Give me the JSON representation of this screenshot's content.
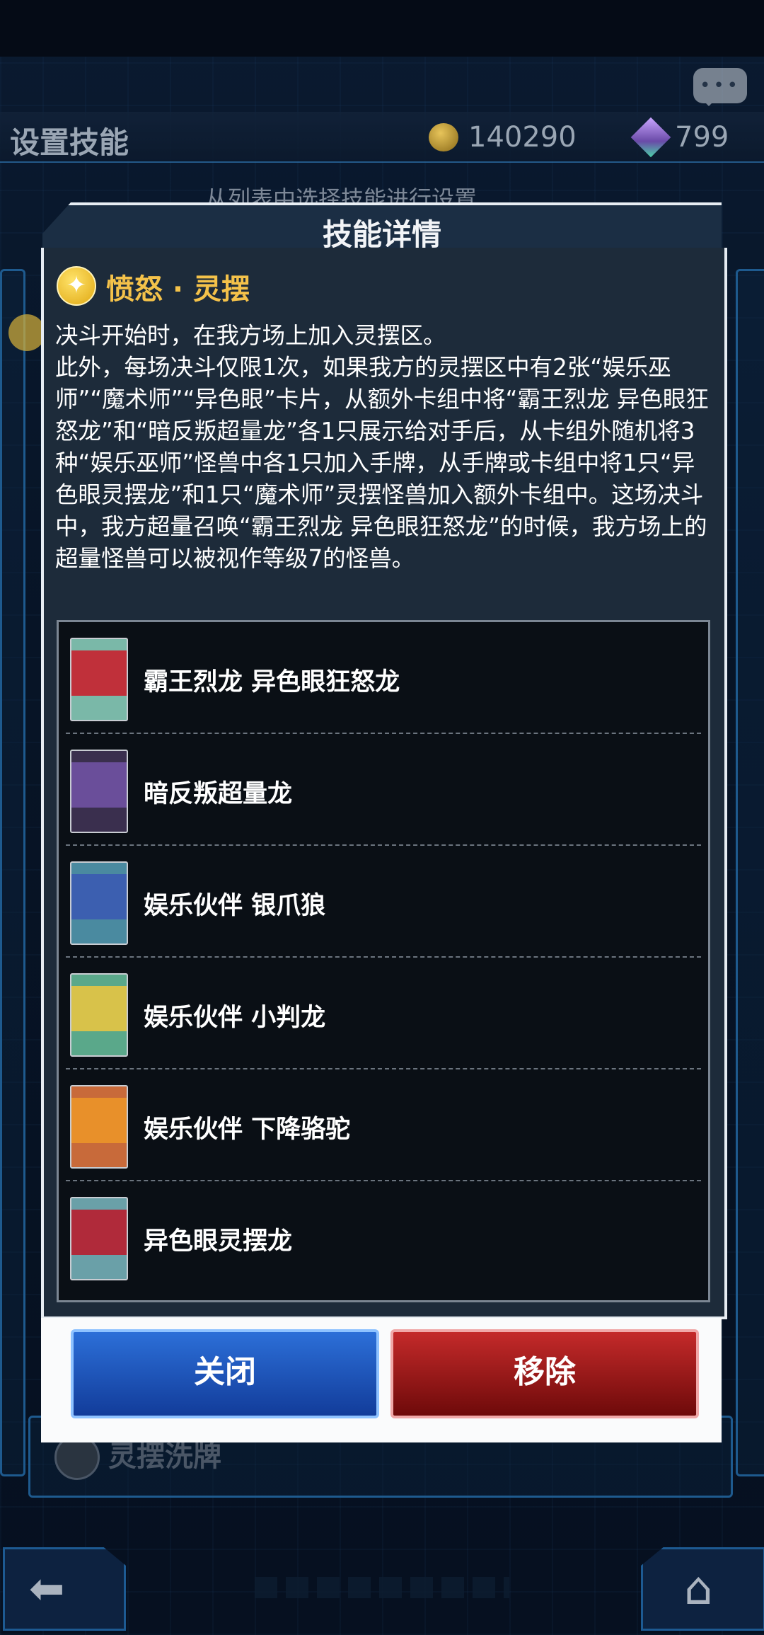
{
  "background": {
    "page_title": "设置技能",
    "gold_amount": "140290",
    "gem_amount": "799",
    "sub_hint": "从列表中选择技能进行设置",
    "bottom_item_label": "灵摆洗牌"
  },
  "modal": {
    "title": "技能详情",
    "skill_name": "愤怒 · 灵摆",
    "description": [
      "决斗开始时，在我方场上加入灵摆区。",
      "此外，每场决斗仅限1次，如果我方的灵摆区中有2张“娱乐巫师”“魔术师”“异色眼”卡片，从额外卡组中将“霸王烈龙 异色眼狂怒龙”和“暗反叛超量龙”各1只展示给对手后，从卡组外随机将3种“娱乐巫师”怪兽中各1只加入手牌，从手牌或卡组中将1只“异色眼灵摆龙”和1只“魔术师”灵摆怪兽加入额外卡组中。这场决斗中，我方超量召唤“霸王烈龙 异色眼狂怒龙”的时候，我方场上的超量怪兽可以被视作等级7的怪兽。"
    ],
    "cards": [
      {
        "name": "霸王烈龙 异色眼狂怒龙",
        "thumb_color": "#7ab8a8",
        "art_color": "#c0303a"
      },
      {
        "name": "暗反叛超量龙",
        "thumb_color": "#3a2f4e",
        "art_color": "#6a4e9a"
      },
      {
        "name": "娱乐伙伴 银爪狼",
        "thumb_color": "#4a8aa0",
        "art_color": "#3c5fb0"
      },
      {
        "name": "娱乐伙伴 小判龙",
        "thumb_color": "#5aa88a",
        "art_color": "#d8c24a"
      },
      {
        "name": "娱乐伙伴 下降骆驼",
        "thumb_color": "#c86a3a",
        "art_color": "#e8902a"
      },
      {
        "name": "异色眼灵摆龙",
        "thumb_color": "#6aa0a8",
        "art_color": "#b02a3a"
      }
    ],
    "close_label": "关闭",
    "remove_label": "移除"
  },
  "colors": {
    "accent_gold": "#f4c24a",
    "close_blue": "#2c6fd8",
    "remove_red": "#c42a2a"
  }
}
